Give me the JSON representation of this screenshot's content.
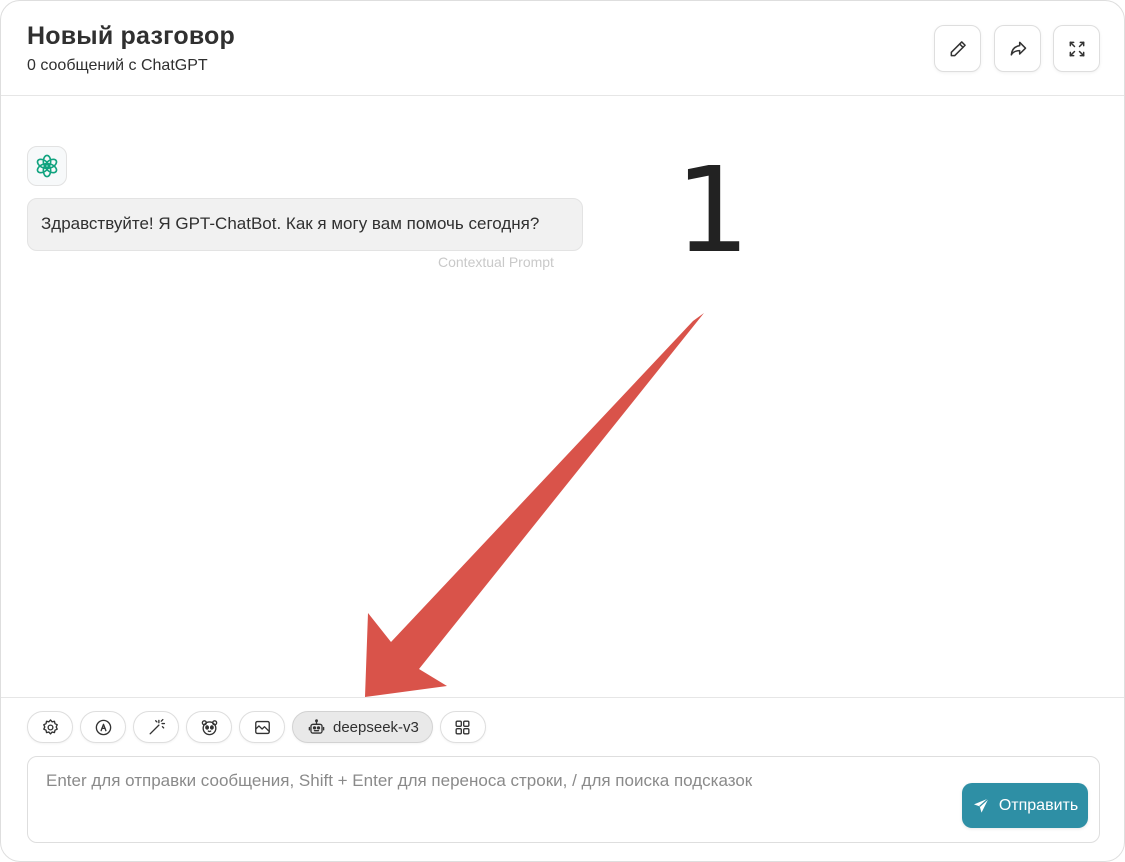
{
  "header": {
    "title": "Новый разговор",
    "subtitle": "0 сообщений с ChatGPT",
    "buttons": [
      {
        "icon": "edit-icon"
      },
      {
        "icon": "share-icon"
      },
      {
        "icon": "fullscreen-icon"
      }
    ]
  },
  "chat": {
    "avatar_icon": "chatgpt-logo-icon",
    "messages": [
      {
        "role": "assistant",
        "text": "Здравствуйте! Я GPT-ChatBot. Как я могу вам помочь сегодня?",
        "label": "Contextual Prompt"
      }
    ]
  },
  "annotation": {
    "number": "1",
    "arrow_color": "#d9534a"
  },
  "toolbar": {
    "items": [
      {
        "icon": "settings-icon"
      },
      {
        "icon": "prompt-icon"
      },
      {
        "icon": "magic-wand-icon"
      },
      {
        "icon": "mask-icon"
      },
      {
        "icon": "image-icon"
      },
      {
        "icon": "robot-icon",
        "label": "deepseek-v3"
      },
      {
        "icon": "apps-grid-icon"
      }
    ]
  },
  "input": {
    "placeholder": "Enter для отправки сообщения, Shift + Enter для переноса строки, / для поиска подсказок",
    "value": ""
  },
  "send": {
    "label": "Отправить",
    "icon": "send-icon",
    "color": "#2e8fa5"
  }
}
